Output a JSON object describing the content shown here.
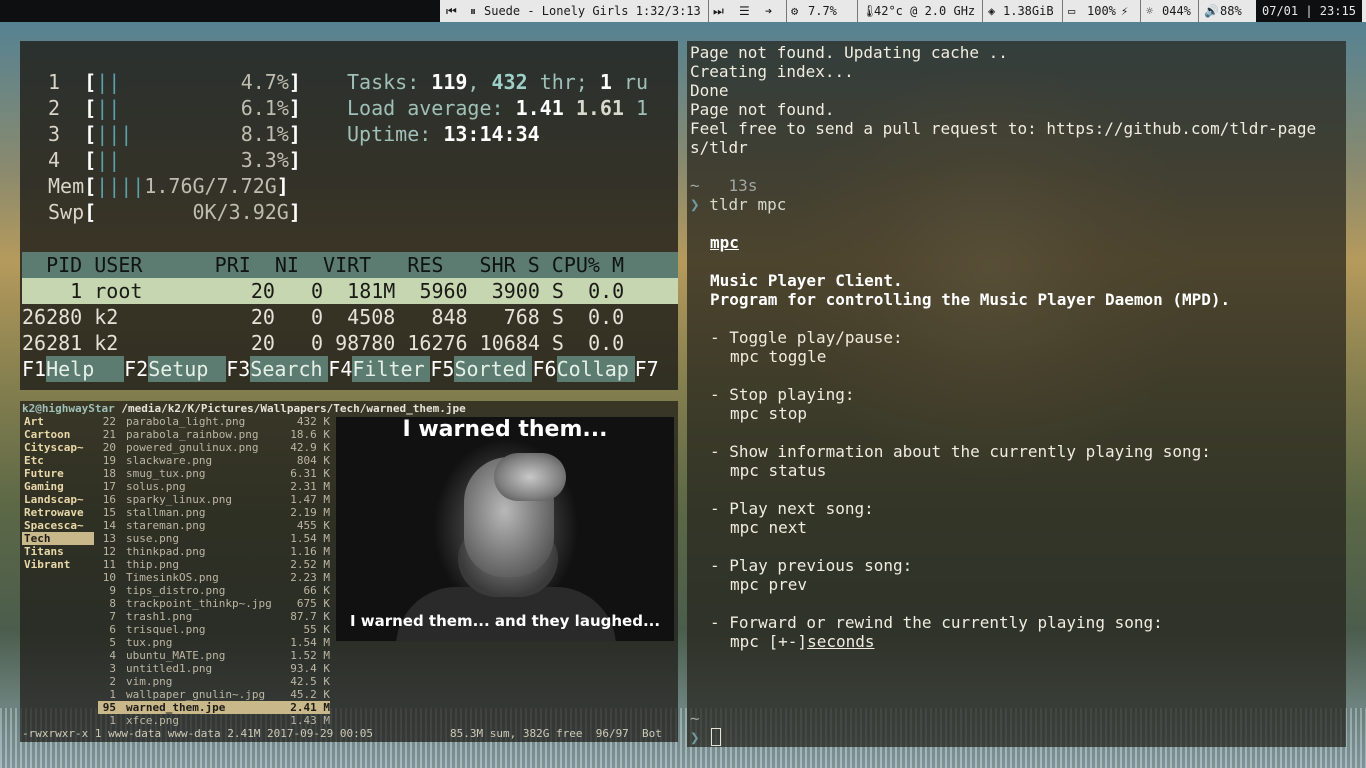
{
  "topbar": {
    "prev_icon": "prev-icon",
    "pause_icon": "pause-icon",
    "now_playing": "Suede - Lonely Girls 1:32/3:13",
    "next_icon": "next-icon",
    "list_icon": "list-icon",
    "arrow_icon": "arrow-right-icon",
    "cpu": "7.7%",
    "temp_freq": "42°c @ 2.0 GHz",
    "mem": "1.38GiB",
    "battery": "100%",
    "brightness": "044%",
    "volume": "88%",
    "clock": "07/01 | 23:15"
  },
  "htop": {
    "cpus": [
      {
        "num": "1",
        "bar": "||",
        "pct": "4.7%"
      },
      {
        "num": "2",
        "bar": "||",
        "pct": "6.1%"
      },
      {
        "num": "3",
        "bar": "|||",
        "pct": "8.1%"
      },
      {
        "num": "4",
        "bar": "||",
        "pct": "3.3%"
      }
    ],
    "mem": {
      "label": "Mem",
      "bar": "||||",
      "value": "1.76G/7.72G"
    },
    "swp": {
      "label": "Swp",
      "value": "0K/3.92G"
    },
    "tasks_label": "Tasks:",
    "tasks": "119",
    "thr": "432",
    "thr_label": "thr;",
    "running": "1",
    "running_label": "ru",
    "load_label": "Load average:",
    "load1": "1.41",
    "load5": "1.61",
    "load15": "1",
    "uptime_label": "Uptime:",
    "uptime": "13:14:34",
    "columns": "  PID USER      PRI  NI  VIRT   RES   SHR S CPU% M",
    "processes": [
      {
        "pid": "    1",
        "user": "root",
        "pri": "20",
        "ni": "0",
        "virt": "181M",
        "res": "5960",
        "shr": "3900",
        "s": "S",
        "cpu": "0.0"
      },
      {
        "pid": "26280",
        "user": "k2",
        "pri": "20",
        "ni": "0",
        "virt": "4508",
        "res": "848",
        "shr": "768",
        "s": "S",
        "cpu": "0.0"
      },
      {
        "pid": "26281",
        "user": "k2",
        "pri": "20",
        "ni": "0",
        "virt": "98780",
        "res": "16276",
        "shr": "10684",
        "s": "S",
        "cpu": "0.0"
      }
    ],
    "fkeys": [
      {
        "key": "F1",
        "label": "Help  "
      },
      {
        "key": "F2",
        "label": "Setup "
      },
      {
        "key": "F3",
        "label": "Search"
      },
      {
        "key": "F4",
        "label": "Filter"
      },
      {
        "key": "F5",
        "label": "Sorted"
      },
      {
        "key": "F6",
        "label": "Collap"
      },
      {
        "key": "F7",
        "label": ""
      }
    ]
  },
  "ranger": {
    "host": "k2@highwayStar",
    "path": "/media/k2/K/Pictures/Wallpapers/Tech/warned_them.jpe",
    "dirs": [
      "Art",
      "Cartoon",
      "Cityscap~",
      "Etc",
      "Future",
      "Gaming",
      "Landscap~",
      "Retrowave",
      "Spacesca~",
      "Tech",
      "Titans",
      "Vibrant"
    ],
    "dir_counts": [
      "22",
      "21",
      "20",
      "19",
      "18",
      "17",
      "16",
      "15",
      "14",
      "13",
      "12",
      "11"
    ],
    "current_dir": "Tech",
    "files": [
      {
        "idx": "",
        "name": "parabola_light.png",
        "size": "432 K"
      },
      {
        "idx": "",
        "name": "parabola_rainbow.png",
        "size": "18.6 K"
      },
      {
        "idx": "",
        "name": "powered_gnulinux.png",
        "size": "42.9 K"
      },
      {
        "idx": "",
        "name": "slackware.png",
        "size": "804 K"
      },
      {
        "idx": "",
        "name": "smug_tux.png",
        "size": "6.31 K"
      },
      {
        "idx": "",
        "name": "solus.png",
        "size": "2.31 M"
      },
      {
        "idx": "",
        "name": "sparky_linux.png",
        "size": "1.47 M"
      },
      {
        "idx": "",
        "name": "stallman.png",
        "size": "2.19 M"
      },
      {
        "idx": "",
        "name": "stareman.png",
        "size": "455 K"
      },
      {
        "idx": "",
        "name": "suse.png",
        "size": "1.54 M"
      },
      {
        "idx": "",
        "name": "thinkpad.png",
        "size": "1.16 M"
      },
      {
        "idx": "",
        "name": "thip.png",
        "size": "2.52 M"
      },
      {
        "idx": "10",
        "name": "TimesinkOS.png",
        "size": "2.23 M"
      },
      {
        "idx": "9",
        "name": "tips_distro.png",
        "size": "66 K"
      },
      {
        "idx": "8",
        "name": "trackpoint_thinkp~.jpg",
        "size": "675 K"
      },
      {
        "idx": "7",
        "name": "trash1.png",
        "size": "87.7 K"
      },
      {
        "idx": "6",
        "name": "trisquel.png",
        "size": "55 K"
      },
      {
        "idx": "5",
        "name": "tux.png",
        "size": "1.54 M"
      },
      {
        "idx": "4",
        "name": "ubuntu_MATE.png",
        "size": "1.52 M"
      },
      {
        "idx": "3",
        "name": "untitled1.png",
        "size": "93.4 K"
      },
      {
        "idx": "2",
        "name": "vim.png",
        "size": "42.5 K"
      },
      {
        "idx": "1",
        "name": "wallpaper_gnulin~.jpg",
        "size": "45.2 K"
      },
      {
        "idx": "95",
        "name": "warned_them.jpe",
        "size": "2.41 M"
      },
      {
        "idx": "1",
        "name": "xfce.png",
        "size": "1.43 M"
      }
    ],
    "selected_file": "warned_them.jpe",
    "preview_top": "I warned them...",
    "preview_bottom": "I warned them... and they laughed...",
    "status_left": "-rwxrwxr-x 1 www-data www-data 2.41M 2017-09-29 00:05",
    "status_right": "85.3M sum, 382G free  96/97  Bot"
  },
  "terminal": {
    "lines": [
      "Page not found. Updating cache ..",
      "Creating index...",
      "Done",
      "Page not found.",
      "Feel free to send a pull request to: https://github.com/tldr-page",
      "s/tldr"
    ],
    "prompt_tilde": "~",
    "duration": "13s",
    "prompt_symbol": "❯",
    "command": "tldr mpc",
    "page_title": "mpc",
    "description1": "Music Player Client.",
    "description2": "Program for controlling the Music Player Daemon (MPD).",
    "entries": [
      {
        "desc": "- Toggle play/pause:",
        "cmd": "mpc toggle"
      },
      {
        "desc": "- Stop playing:",
        "cmd": "mpc stop"
      },
      {
        "desc": "- Show information about the currently playing song:",
        "cmd": "mpc status"
      },
      {
        "desc": "- Play next song:",
        "cmd": "mpc next"
      },
      {
        "desc": "- Play previous song:",
        "cmd": "mpc prev"
      },
      {
        "desc": "- Forward or rewind the currently playing song:",
        "cmd": "mpc [+-]",
        "arg": "seconds"
      }
    ]
  },
  "colors": {
    "accent": "#5c7c72",
    "selection": "#c9b88a",
    "bar_bg": "#e8e8e8"
  }
}
